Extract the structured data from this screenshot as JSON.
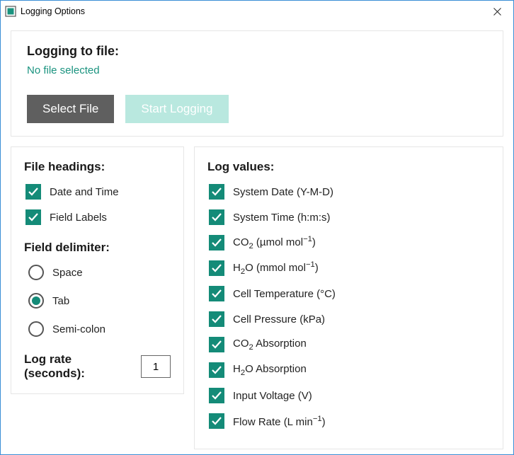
{
  "window": {
    "title": "Logging Options"
  },
  "top": {
    "heading": "Logging to file:",
    "file_status": "No file selected",
    "select_file_btn": "Select File",
    "start_logging_btn": "Start Logging"
  },
  "left": {
    "headings_label": "File headings:",
    "headings": [
      {
        "label": "Date and Time",
        "checked": true
      },
      {
        "label": "Field Labels",
        "checked": true
      }
    ],
    "delimiter_label": "Field delimiter:",
    "delimiters": [
      {
        "label": "Space",
        "selected": false
      },
      {
        "label": "Tab",
        "selected": true
      },
      {
        "label": "Semi-colon",
        "selected": false
      }
    ],
    "log_rate_label": "Log rate (seconds):",
    "log_rate_value": "1"
  },
  "right": {
    "heading": "Log values:",
    "items": [
      {
        "label_html": "System Date (Y-M-D)",
        "checked": true
      },
      {
        "label_html": "System Time (h:m:s)",
        "checked": true
      },
      {
        "label_html": "CO<sub>2</sub> (µmol mol<sup>−1</sup>)",
        "checked": true
      },
      {
        "label_html": "H<sub>2</sub>O (mmol mol<sup>−1</sup>)",
        "checked": true
      },
      {
        "label_html": "Cell Temperature (°C)",
        "checked": true
      },
      {
        "label_html": "Cell Pressure (kPa)",
        "checked": true
      },
      {
        "label_html": "CO<sub>2</sub> Absorption",
        "checked": true
      },
      {
        "label_html": "H<sub>2</sub>O Absorption",
        "checked": true
      },
      {
        "label_html": "Input Voltage (V)",
        "checked": true
      },
      {
        "label_html": "Flow Rate (L min<sup>−1</sup>)",
        "checked": true
      }
    ]
  }
}
